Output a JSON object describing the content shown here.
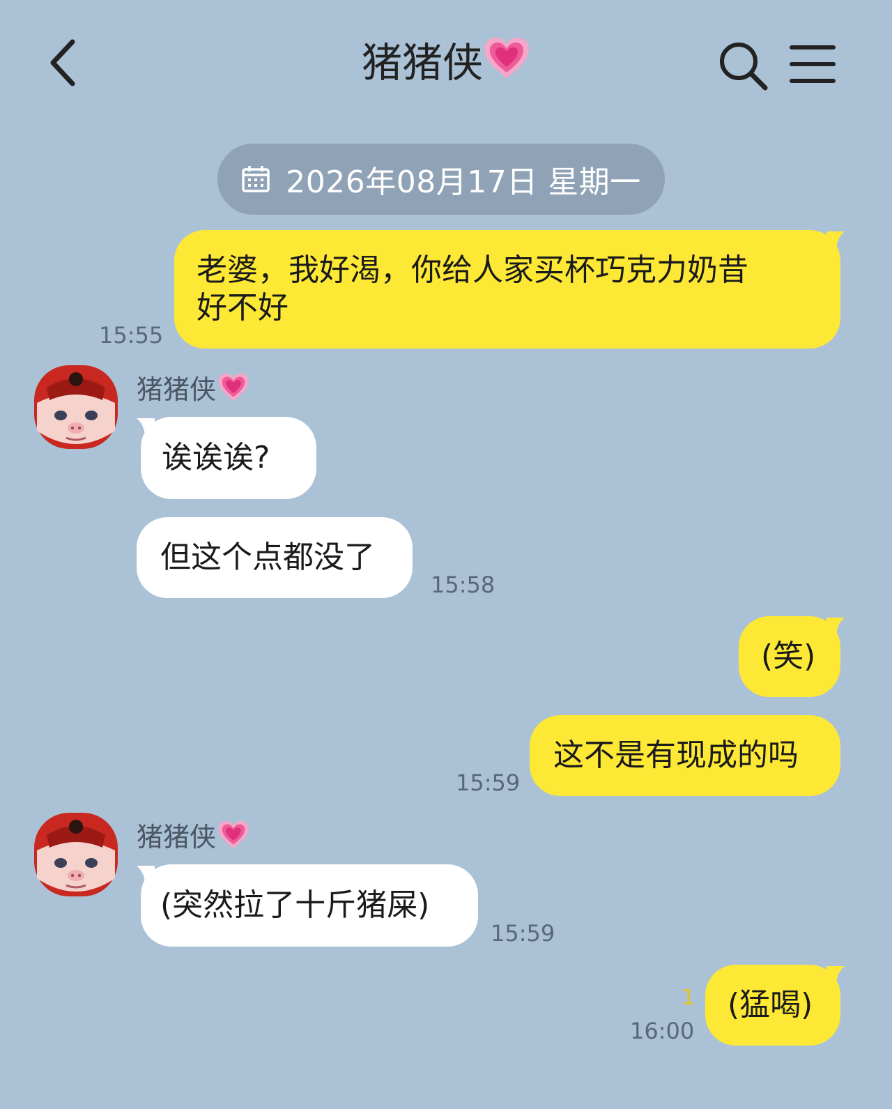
{
  "header": {
    "title": "猪猪侠",
    "title_emoji_icon": "growing-heart-icon",
    "back_icon": "chevron-left-icon",
    "search_icon": "search-icon",
    "menu_icon": "hamburger-menu-icon"
  },
  "date_divider": {
    "icon": "calendar-icon",
    "text": "2026年08月17日 星期一"
  },
  "contact": {
    "name": "猪猪侠",
    "emoji_icon": "growing-heart-icon",
    "avatar_icon": "pig-hero-avatar"
  },
  "messages": [
    {
      "side": "out",
      "lines": [
        "老婆，我好渴，你给人家买杯巧克力奶昔",
        "好不好"
      ],
      "time": "15:55"
    },
    {
      "side": "in",
      "text": "诶诶诶?"
    },
    {
      "side": "in",
      "text": "但这个点都没了",
      "time": "15:58"
    },
    {
      "side": "out",
      "text": "(笑)"
    },
    {
      "side": "out",
      "text": "这不是有现成的吗",
      "time": "15:59"
    },
    {
      "side": "in",
      "text": "(突然拉了十斤猪屎)",
      "time": "15:59"
    },
    {
      "side": "out",
      "text": "(猛喝)",
      "time": "16:00",
      "unread": "1"
    }
  ],
  "colors": {
    "background": "#abc1d6",
    "outgoing_bubble": "#fde935",
    "incoming_bubble": "#ffffff",
    "date_pill": "#8fa2b6"
  }
}
